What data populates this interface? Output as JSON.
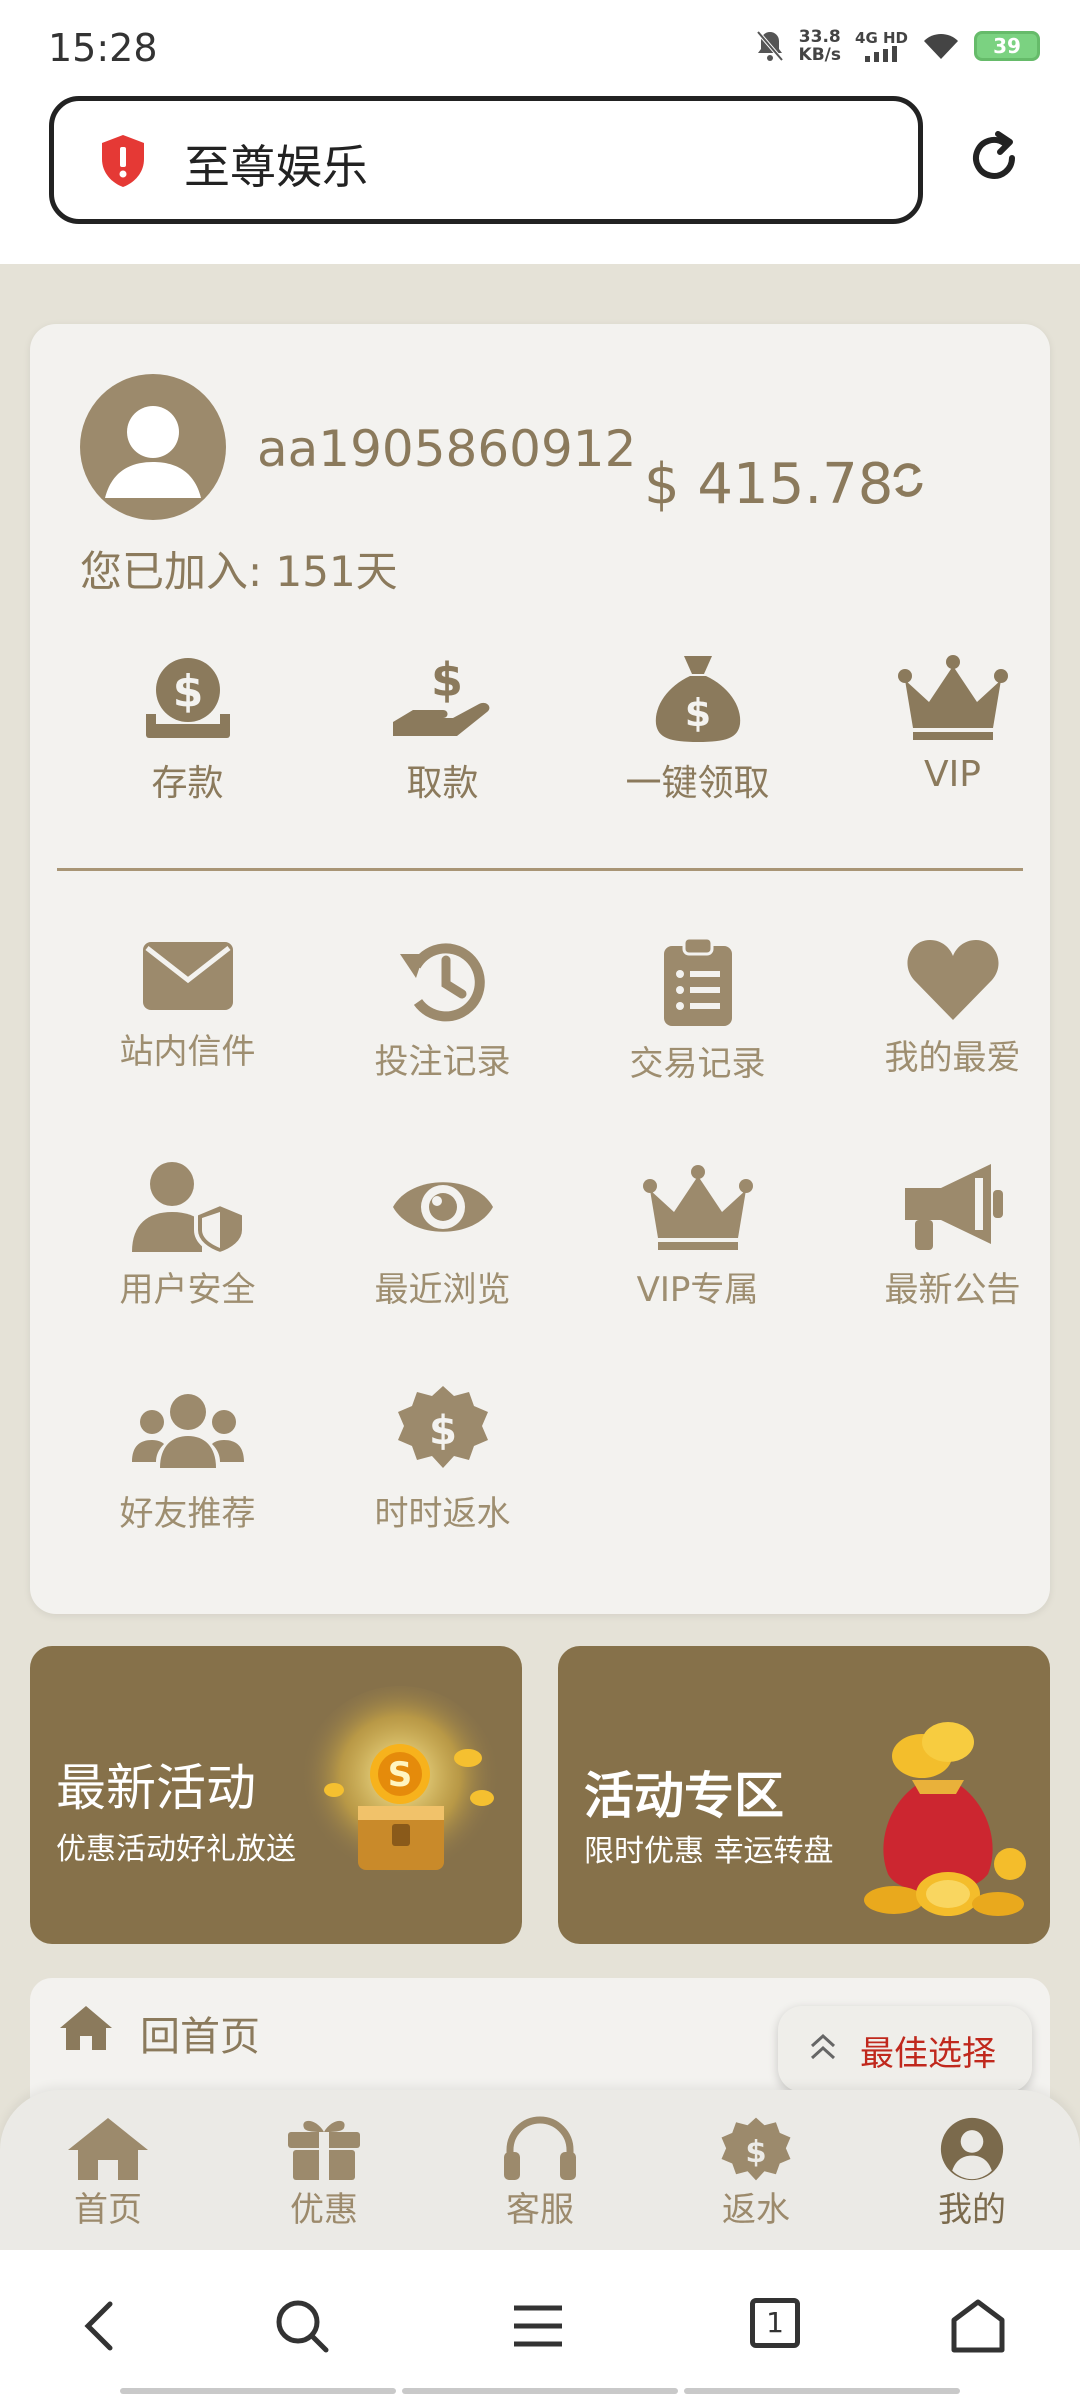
{
  "status_bar": {
    "time": "15:28",
    "net_speed": "33.8",
    "net_unit": "KB/s",
    "network": "4G HD",
    "battery": "39"
  },
  "browser": {
    "site_title": "至尊娱乐"
  },
  "profile": {
    "username": "aa1905860912",
    "balance": "$ 415.78",
    "joined": "您已加入: 151天"
  },
  "quick_actions": [
    {
      "label": "存款",
      "icon": "deposit-icon"
    },
    {
      "label": "取款",
      "icon": "withdraw-icon"
    },
    {
      "label": "一键领取",
      "icon": "money-bag-icon"
    },
    {
      "label": "VIP",
      "icon": "crown-icon"
    }
  ],
  "menu": [
    {
      "label": "站内信件",
      "icon": "mail-icon"
    },
    {
      "label": "投注记录",
      "icon": "history-icon"
    },
    {
      "label": "交易记录",
      "icon": "clipboard-list-icon"
    },
    {
      "label": "我的最爱",
      "icon": "heart-icon"
    },
    {
      "label": "用户安全",
      "icon": "user-shield-icon"
    },
    {
      "label": "最近浏览",
      "icon": "eye-icon"
    },
    {
      "label": "VIP专属",
      "icon": "crown-icon"
    },
    {
      "label": "最新公告",
      "icon": "megaphone-icon"
    },
    {
      "label": "好友推荐",
      "icon": "users-icon"
    },
    {
      "label": "时时返水",
      "icon": "dollar-badge-icon"
    }
  ],
  "banners": [
    {
      "title": "最新活动",
      "subtitle": "优惠活动好礼放送"
    },
    {
      "title": "活动专区",
      "subtitle": "限时优惠 幸运转盘"
    }
  ],
  "home_link": "回首页",
  "best_choice": "最佳选择",
  "bottom_nav": [
    {
      "label": "首页",
      "icon": "home-icon"
    },
    {
      "label": "优惠",
      "icon": "gift-icon"
    },
    {
      "label": "客服",
      "icon": "headset-icon"
    },
    {
      "label": "返水",
      "icon": "dollar-badge-icon"
    },
    {
      "label": "我的",
      "icon": "user-circle-icon"
    }
  ],
  "browser_tabs_count": "1",
  "colors": {
    "accent": "#8b7a5c",
    "banner_bg": "#86714a",
    "best_choice_text": "#c0281d",
    "background": "#e5e2d7"
  }
}
